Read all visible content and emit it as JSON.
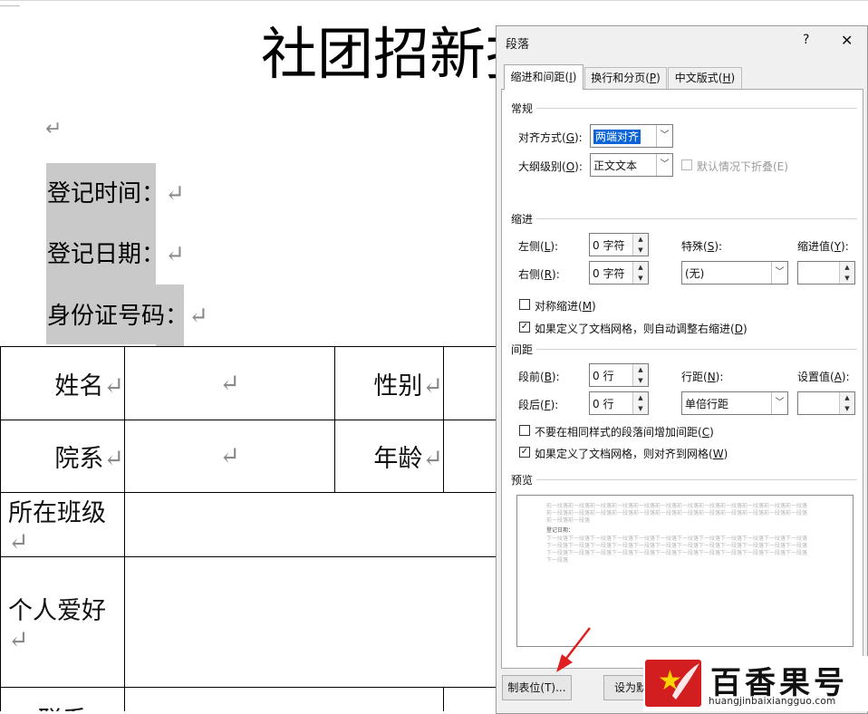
{
  "document": {
    "title": "社团招新报",
    "return_mark": "↵",
    "fields": [
      "登记时间：",
      "登记日期：",
      "身份证号码："
    ],
    "table": {
      "row1": {
        "label": "姓名",
        "label2": "性别"
      },
      "row2": {
        "label": "院系",
        "label2": "年龄"
      },
      "row3": {
        "label": "所在班级"
      },
      "row4": {
        "label": "个人爱好"
      },
      "row5": {
        "label": "联系"
      }
    }
  },
  "dialog": {
    "title": "段落",
    "help": "?",
    "close": "✕",
    "tabs": [
      {
        "label": "缩进和间距(",
        "key": "I",
        "suffix": ")"
      },
      {
        "label": "换行和分页(",
        "key": "P",
        "suffix": ")"
      },
      {
        "label": "中文版式(",
        "key": "H",
        "suffix": ")"
      }
    ],
    "general": {
      "section": "常规",
      "alignment_label": "对齐方式(",
      "alignment_key": "G",
      "alignment_value": "两端对齐",
      "outline_label": "大纲级别(",
      "outline_key": "O",
      "outline_value": "正文文本",
      "collapse_label": "默认情况下折叠(E)"
    },
    "indent": {
      "section": "缩进",
      "left_label": "左侧(",
      "left_key": "L",
      "left_value": "0 字符",
      "right_label": "右侧(",
      "right_key": "R",
      "right_value": "0 字符",
      "special_label": "特殊(",
      "special_key": "S",
      "special_value": "(无)",
      "indent_value_label": "缩进值(",
      "indent_value_key": "Y",
      "mirror_label": "对称缩进(",
      "mirror_key": "M",
      "auto_adjust_label": "如果定义了文档网格，则自动调整右缩进(",
      "auto_adjust_key": "D"
    },
    "spacing": {
      "section": "间距",
      "before_label": "段前(",
      "before_key": "B",
      "before_value": "0 行",
      "after_label": "段后(",
      "after_key": "F",
      "after_value": "0 行",
      "line_label": "行距(",
      "line_key": "N",
      "line_value": "单倍行距",
      "at_label": "设置值(",
      "at_key": "A",
      "no_space_label": "不要在相同样式的段落间增加间距(",
      "no_space_key": "C",
      "snap_label": "如果定义了文档网格，则对齐到网格(",
      "snap_key": "W"
    },
    "preview": {
      "section": "预览",
      "before_text": "前一段落前一段落前一段落前一段落前一段落前一段落前一段落前一段落前一段落前一段落前一段落前一段落前一段落前一段落前一段落前一段落前一段落前一段落前一段落前一段落前一段落前一段落前一段落前一段落前一段落前一段落",
      "sample_text": "登记日期：",
      "after_text": "下一段落下一段落下一段落下一段落下一段落下一段落下一段落下一段落下一段落下一段落下一段落下一段落下一段落下一段落下一段落下一段落下一段落下一段落下一段落下一段落下一段落下一段落下一段落下一段落下一段落下一段落下一段落下一段落下一段落下一段落下一段落下一段落下一段落下一段落下一段落下一段落下一段落"
    },
    "buttons": {
      "tabs_button": "制表位(T)...",
      "default_button": "设为默"
    }
  },
  "watermark": {
    "name": "百香果号",
    "url": "huangjinbaixiangguo.com"
  },
  "colors": {
    "highlight": "#c9c9c9",
    "selection": "#0a64d6",
    "annotation_arrow": "#e02020",
    "logo_bg": "#d21e1e"
  }
}
